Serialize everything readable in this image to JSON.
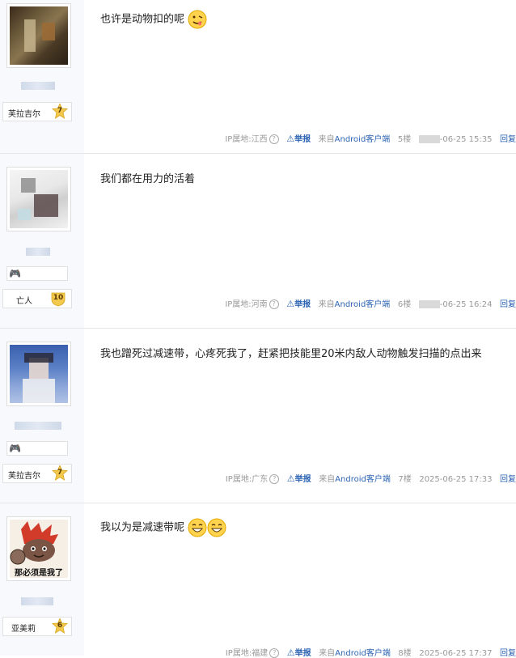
{
  "posts": [
    {
      "content": "也许是动物扣的呢",
      "badge_label": "芙拉吉尔",
      "badge_level": "7",
      "ip": "IP属地:江西",
      "report": "举报",
      "source_prefix": "来自",
      "source_client": "Android客户端",
      "floor": "5楼",
      "date": "-06-25 15:35",
      "reply": "回复"
    },
    {
      "content": "我们都在用力的活着",
      "badge_label": "亡人",
      "badge_level": "10",
      "ip": "IP属地:河南",
      "report": "举报",
      "source_prefix": "来自",
      "source_client": "Android客户端",
      "floor": "6楼",
      "date": "-06-25 16:24",
      "reply": "回复"
    },
    {
      "content": "我也蹭死过减速带，心疼死我了，赶紧把技能里20米内敌人动物触发扫描的点出来",
      "badge_label": "芙拉吉尔",
      "badge_level": "7",
      "ip": "IP属地:广东",
      "report": "举报",
      "source_prefix": "来自",
      "source_client": "Android客户端",
      "floor": "7楼",
      "date": "2025-06-25 17:33",
      "reply": "回复"
    },
    {
      "content": "我以为是减速带呢",
      "avatar_caption": "那必须是我了",
      "badge_label": "亚美莉",
      "badge_level": "6",
      "ip": "IP属地:福建",
      "report": "举报",
      "source_prefix": "来自",
      "source_client": "Android客户端",
      "floor": "8楼",
      "date": "2025-06-25 17:37",
      "reply": "回复"
    }
  ],
  "colors": {
    "sidebar_bg": "#f7f9fc",
    "link_blue": "#2d64b3",
    "badge_gold": "#f2c94c"
  },
  "icons": {
    "emoji": "smiley-emoji-icon",
    "report": "warning-triangle-icon",
    "help": "question-circle-icon",
    "game": "gamepad-icon",
    "level": "level-star-icon"
  }
}
